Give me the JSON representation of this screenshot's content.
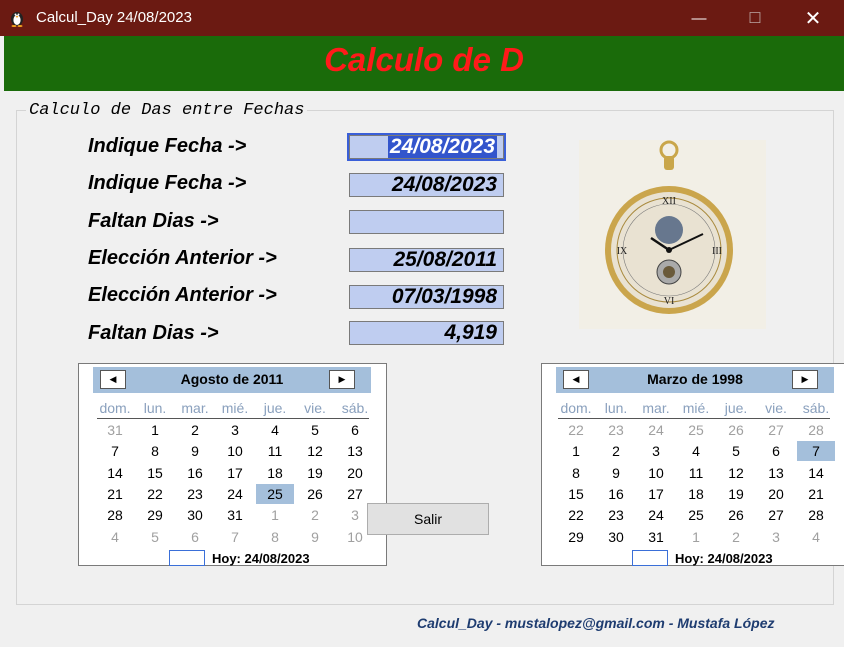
{
  "window": {
    "title": "Calcul_Day   24/08/2023",
    "minimize_glyph": "—",
    "maximize_glyph": "☐",
    "close_glyph": "✕",
    "icon": "penguin-icon"
  },
  "banner": {
    "text": "Calculo de D",
    "color": "#ff1a1a",
    "background": "#1a6b0a"
  },
  "group": {
    "title": "Calculo de Das entre Fechas"
  },
  "rows": [
    {
      "label": "Indique Fecha  ->",
      "value": "24/08/2023",
      "focused": true
    },
    {
      "label": "Indique Fecha  ->",
      "value": "24/08/2023"
    },
    {
      "label": "Faltan Dias  ->",
      "value": ""
    },
    {
      "label": "Elección Anterior ->",
      "value": "25/08/2011"
    },
    {
      "label": "Elección Anterior ->",
      "value": "07/03/1998"
    },
    {
      "label": "Faltan Dias  ->",
      "value": "4,919"
    }
  ],
  "watch": {
    "icon": "pocket-watch-image"
  },
  "weekdays": [
    "dom.",
    "lun.",
    "mar.",
    "mié.",
    "jue.",
    "vie.",
    "sáb."
  ],
  "calendars": [
    {
      "title": "Agosto de 2011",
      "prev": "◀",
      "next": "▶",
      "weeks": [
        [
          "31",
          "1",
          "2",
          "3",
          "4",
          "5",
          "6"
        ],
        [
          "7",
          "8",
          "9",
          "10",
          "11",
          "12",
          "13"
        ],
        [
          "14",
          "15",
          "16",
          "17",
          "18",
          "19",
          "20"
        ],
        [
          "21",
          "22",
          "23",
          "24",
          "25",
          "26",
          "27"
        ],
        [
          "28",
          "29",
          "30",
          "31",
          "1",
          "2",
          "3"
        ],
        [
          "4",
          "5",
          "6",
          "7",
          "8",
          "9",
          "10"
        ]
      ],
      "selected": "25",
      "today": "Hoy: 24/08/2023"
    },
    {
      "title": "Marzo de 1998",
      "prev": "◀",
      "next": "▶",
      "weeks": [
        [
          "22",
          "23",
          "24",
          "25",
          "26",
          "27",
          "28"
        ],
        [
          "1",
          "2",
          "3",
          "4",
          "5",
          "6",
          "7"
        ],
        [
          "8",
          "9",
          "10",
          "11",
          "12",
          "13",
          "14"
        ],
        [
          "15",
          "16",
          "17",
          "18",
          "19",
          "20",
          "21"
        ],
        [
          "22",
          "23",
          "24",
          "25",
          "26",
          "27",
          "28"
        ],
        [
          "29",
          "30",
          "31",
          "1",
          "2",
          "3",
          "4"
        ]
      ],
      "selected": "7",
      "today": "Hoy: 24/08/2023"
    }
  ],
  "buttons": {
    "salir": "Salir"
  },
  "footer": "Calcul_Day - mustalopez@gmail.com - Mustafa López",
  "colors": {
    "titlebar": "#6b1a12",
    "field": "#bfcdf0",
    "calendar_header": "#a4bfdb"
  }
}
